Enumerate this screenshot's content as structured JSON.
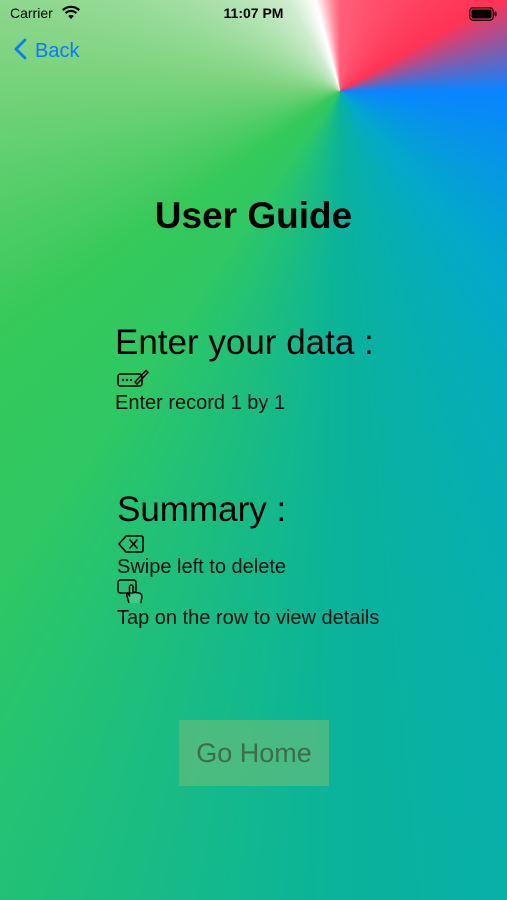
{
  "status_bar": {
    "carrier": "Carrier",
    "time": "11:07 PM"
  },
  "nav": {
    "back_label": "Back"
  },
  "page": {
    "title": "User Guide"
  },
  "enter_section": {
    "heading": "Enter your data :",
    "instruction": "Enter record 1 by 1",
    "icon": "pencil-rectangle-icon"
  },
  "summary_section": {
    "heading": "Summary :",
    "delete_instruction": "Swipe left to delete",
    "delete_icon": "delete-left-icon",
    "details_instruction": "Tap on the row to view details",
    "details_icon": "hand-tap-icon"
  },
  "footer": {
    "go_home_label": "Go Home"
  }
}
